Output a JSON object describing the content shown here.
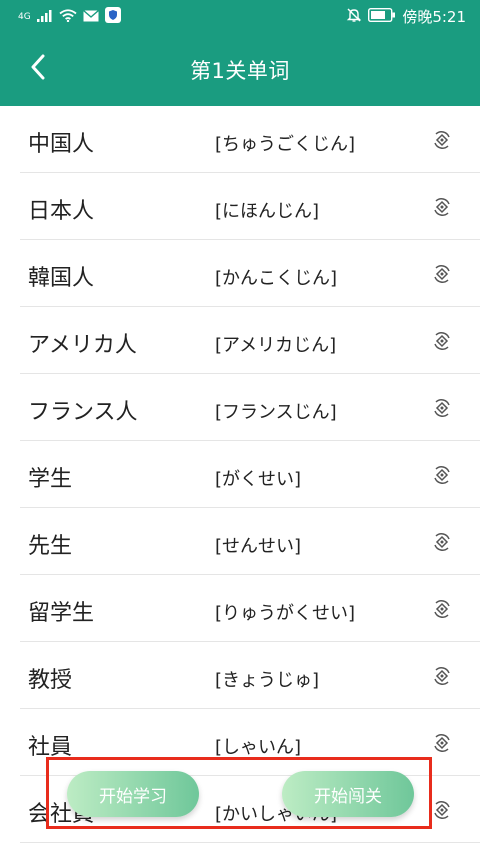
{
  "status": {
    "signal_text": "4G",
    "carrier_time": "傍晚5:21"
  },
  "header": {
    "title": "第1关单词"
  },
  "words": [
    {
      "word": "中国人",
      "reading": "[ちゅうごくじん]"
    },
    {
      "word": "日本人",
      "reading": "[にほんじん]"
    },
    {
      "word": "韓国人",
      "reading": "[かんこくじん]"
    },
    {
      "word": "アメリカ人",
      "reading": "[アメリカじん]"
    },
    {
      "word": "フランス人",
      "reading": "[フランスじん]"
    },
    {
      "word": "学生",
      "reading": "[がくせい]"
    },
    {
      "word": "先生",
      "reading": "[せんせい]"
    },
    {
      "word": "留学生",
      "reading": "[りゅうがくせい]"
    },
    {
      "word": "教授",
      "reading": "[きょうじゅ]"
    },
    {
      "word": "社員",
      "reading": "[しゃいん]"
    },
    {
      "word": "会社員",
      "reading": "[かいしゃいん]"
    }
  ],
  "actions": {
    "start_learning": "开始学习",
    "start_challenge": "开始闯关"
  },
  "colors": {
    "header_bg": "#1a9c80",
    "highlight_border": "#e82c1c",
    "pill_gradient_start": "#bdecc4",
    "pill_gradient_end": "#6fc79a"
  }
}
